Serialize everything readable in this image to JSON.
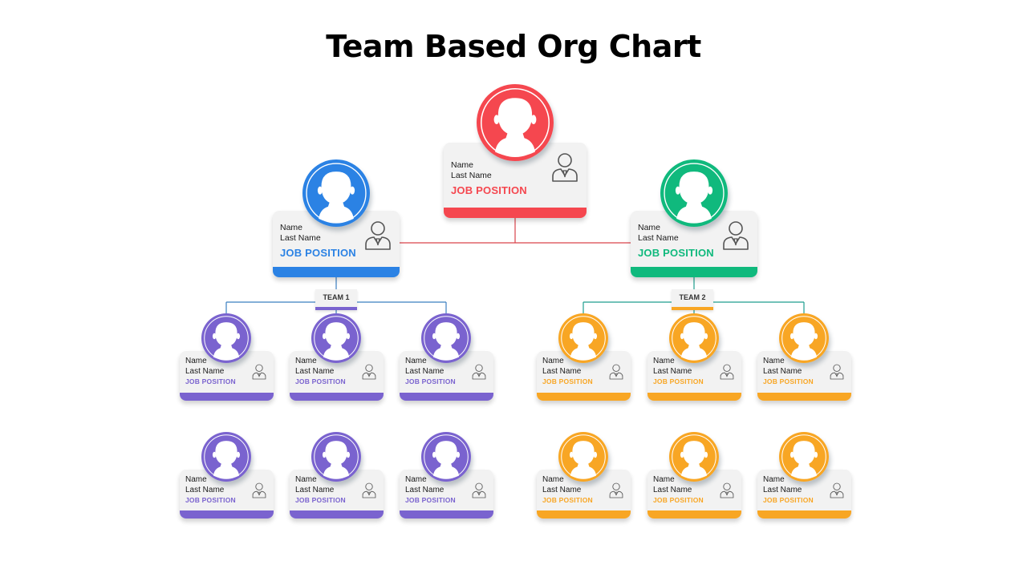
{
  "title": "Team Based Org Chart",
  "colors": {
    "red": "#f5474f",
    "blue": "#2b82e4",
    "green": "#10b97d",
    "purple": "#7a63cf",
    "orange": "#f8a624",
    "card_bg": "#f2f2f2",
    "line_red": "#d9434b",
    "line_blue": "#3b7fc0",
    "line_teal": "#1d9e8e"
  },
  "head": {
    "name": "Name",
    "last_name": "Last Name",
    "position": "JOB POSITION",
    "color": "red",
    "icon": "person-avatar-icon",
    "badge_icon": "user-tie-icon"
  },
  "managers": [
    {
      "name": "Name",
      "last_name": "Last Name",
      "position": "JOB POSITION",
      "color": "blue",
      "team_label": "TEAM 1"
    },
    {
      "name": "Name",
      "last_name": "Last Name",
      "position": "JOB POSITION",
      "color": "green",
      "team_label": "TEAM 2"
    }
  ],
  "teams": [
    {
      "label": "TEAM 1",
      "color": "purple",
      "members": [
        {
          "name": "Name",
          "last_name": "Last Name",
          "position": "JOB POSITION"
        },
        {
          "name": "Name",
          "last_name": "Last Name",
          "position": "JOB POSITION"
        },
        {
          "name": "Name",
          "last_name": "Last Name",
          "position": "JOB POSITION"
        },
        {
          "name": "Name",
          "last_name": "Last Name",
          "position": "JOB POSITION"
        },
        {
          "name": "Name",
          "last_name": "Last Name",
          "position": "JOB POSITION"
        },
        {
          "name": "Name",
          "last_name": "Last Name",
          "position": "JOB POSITION"
        }
      ]
    },
    {
      "label": "TEAM 2",
      "color": "orange",
      "members": [
        {
          "name": "Name",
          "last_name": "Last Name",
          "position": "JOB POSITION"
        },
        {
          "name": "Name",
          "last_name": "Last Name",
          "position": "JOB POSITION"
        },
        {
          "name": "Name",
          "last_name": "Last Name",
          "position": "JOB POSITION"
        },
        {
          "name": "Name",
          "last_name": "Last Name",
          "position": "JOB POSITION"
        },
        {
          "name": "Name",
          "last_name": "Last Name",
          "position": "JOB POSITION"
        },
        {
          "name": "Name",
          "last_name": "Last Name",
          "position": "JOB POSITION"
        }
      ]
    }
  ]
}
